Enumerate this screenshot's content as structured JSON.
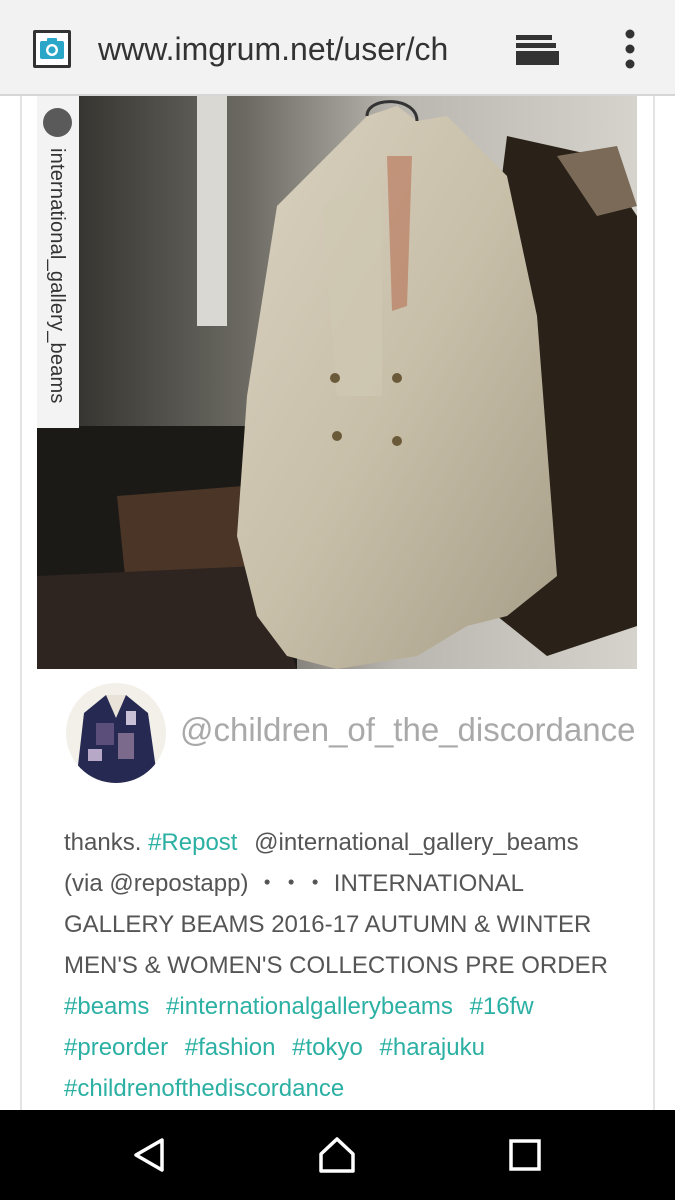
{
  "browser": {
    "url": "www.imgrum.net/user/ch",
    "site_icon": "camera-icon",
    "tabs_icon": "tabs-stack-icon",
    "menu_icon": "overflow-menu-icon"
  },
  "post": {
    "photo_watermark": "international_gallery_beams",
    "username": "@children_of_the_discordance",
    "caption": {
      "thanks": "thanks.",
      "repost_tag": "#Repost",
      "mention": "@international_gallery_beams",
      "via": "(via @repostapp) ・・・ INTERNATIONAL",
      "line3": "GALLERY BEAMS 2016-17 AUTUMN & WINTER",
      "line4": "MEN'S & WOMEN'S COLLECTIONS PRE ORDER",
      "hashtags": [
        "#beams",
        "#internationalgallerybeams",
        "#16fw",
        "#preorder",
        "#fashion",
        "#tokyo",
        "#harajuku",
        "#childrenofthediscordance"
      ]
    }
  },
  "navbar": {
    "back_icon": "back-triangle-icon",
    "home_icon": "home-icon",
    "recents_icon": "recents-square-icon"
  },
  "colors": {
    "hashtag": "#2bb0a3",
    "username": "#a9a9a9",
    "caption_text": "#555555",
    "topbar": "#f2f2f2",
    "navbar": "#000000"
  }
}
